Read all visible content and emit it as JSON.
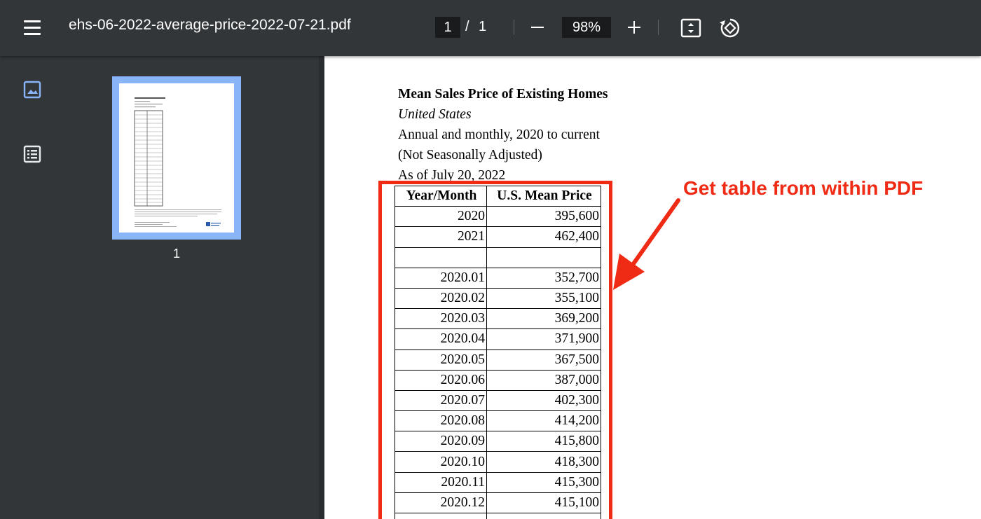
{
  "toolbar": {
    "filename": "ehs-06-2022-average-price-2022-07-21.pdf",
    "page_current": "1",
    "page_separator": "/",
    "page_total": "1",
    "zoom": "98%",
    "icons": {
      "menu": "menu-icon",
      "zoom_out": "minus-icon",
      "zoom_in": "plus-icon",
      "fit": "fit-to-page-icon",
      "rotate": "rotate-icon"
    }
  },
  "sidebar": {
    "thumbnail_label": "1",
    "icons": {
      "thumbnails": "image-icon",
      "outline": "list-icon"
    },
    "accent": "#8ab4f8"
  },
  "document": {
    "title": "Mean Sales Price of Existing Homes",
    "subtitle": "United States",
    "line1": "Annual and monthly, 2020 to current",
    "line2": "(Not Seasonally Adjusted)",
    "line3": "As of July 20, 2022",
    "table": {
      "headers": [
        "Year/Month",
        "U.S. Mean Price"
      ],
      "rows": [
        [
          "2020",
          "395,600"
        ],
        [
          "2021",
          "462,400"
        ],
        [
          "",
          ""
        ],
        [
          "2020.01",
          "352,700"
        ],
        [
          "2020.02",
          "355,100"
        ],
        [
          "2020.03",
          "369,200"
        ],
        [
          "2020.04",
          "371,900"
        ],
        [
          "2020.05",
          "367,500"
        ],
        [
          "2020.06",
          "387,000"
        ],
        [
          "2020.07",
          "402,300"
        ],
        [
          "2020.08",
          "414,200"
        ],
        [
          "2020.09",
          "415,800"
        ],
        [
          "2020.10",
          "418,300"
        ],
        [
          "2020.11",
          "415,300"
        ],
        [
          "2020.12",
          "415,100"
        ],
        [
          "",
          ""
        ]
      ]
    }
  },
  "annotation": {
    "text": "Get table from within PDF",
    "color": "#ef2b15"
  }
}
